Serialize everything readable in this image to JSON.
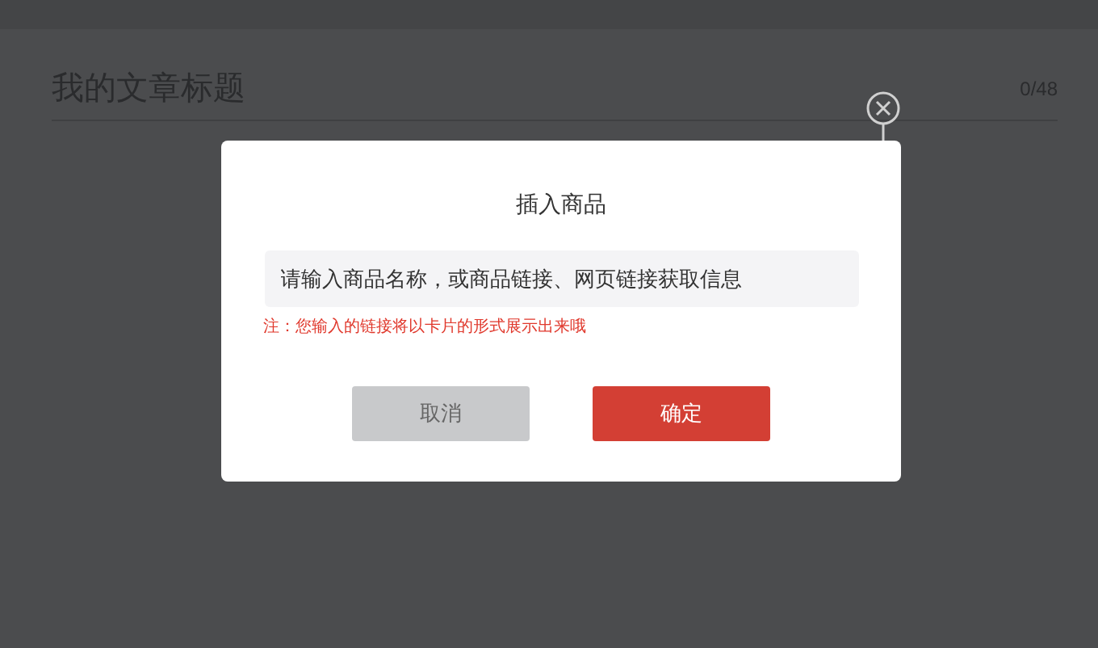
{
  "editor": {
    "title_placeholder": "我的文章标题",
    "counter": "0/48"
  },
  "dialog": {
    "title": "插入商品",
    "field": {
      "placeholder": "请输入商品名称，或商品链接、网页链接获取信息"
    },
    "note": "注：您输入的链接将以卡片的形式展示出来哦",
    "buttons": [
      {
        "kind": "secondary",
        "label": "取消"
      },
      {
        "kind": "primary",
        "label": "确定"
      }
    ]
  }
}
